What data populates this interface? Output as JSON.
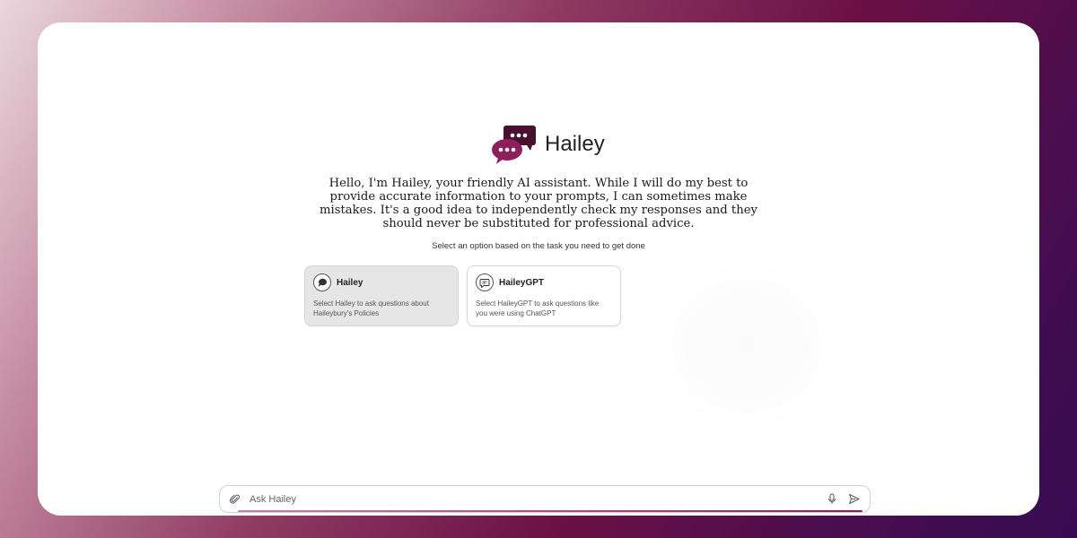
{
  "brand": {
    "name": "Hailey",
    "logo_icon": "chat-bubbles-icon",
    "accent": "#7b1a4f"
  },
  "intro": {
    "text": "Hello, I'm Hailey, your friendly AI assistant. While I will do my best to provide accurate information to your prompts, I can sometimes make mistakes. It's a good idea to independently check my responses and they should never be substituted for professional advice."
  },
  "options": {
    "prompt": "Select an option based on the task you need to get done",
    "items": [
      {
        "title": "Hailey",
        "description": "Select Hailey to ask questions about Haileybury's Policies",
        "icon": "chat-bubble-icon",
        "selected": true
      },
      {
        "title": "HaileyGPT",
        "description": "Select HaileyGPT to ask questions like you were using ChatGPT",
        "icon": "message-square-icon",
        "selected": false
      }
    ]
  },
  "composer": {
    "placeholder": "Ask Hailey",
    "value": "",
    "attach_icon": "paperclip-icon",
    "mic_icon": "microphone-icon",
    "send_icon": "send-icon"
  }
}
